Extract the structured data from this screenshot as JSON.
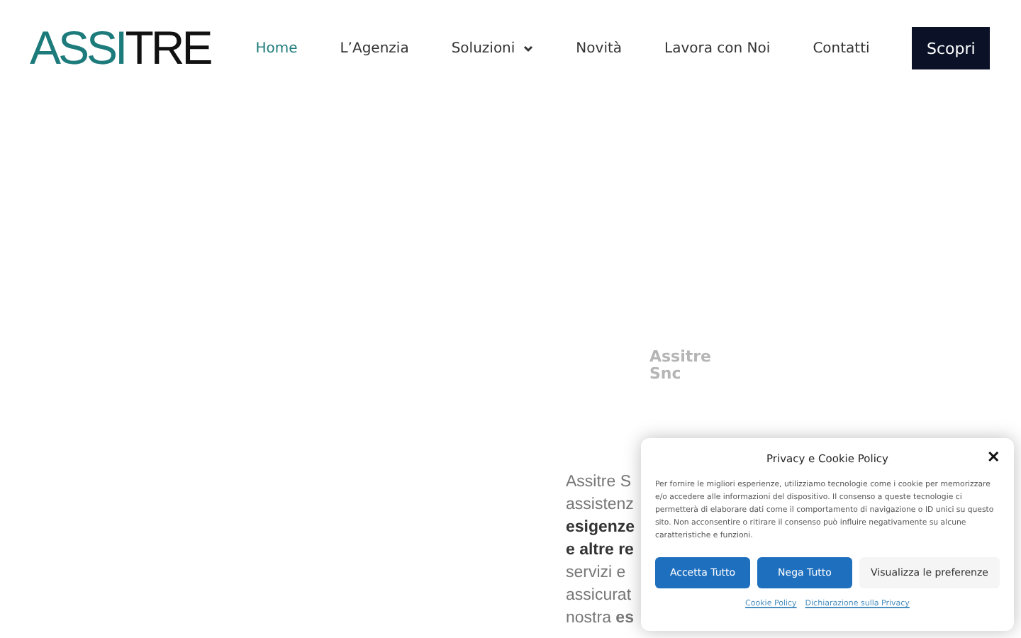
{
  "header": {
    "logo": [
      {
        "text": "ASSI",
        "color": "#1e7b7c"
      },
      {
        "text": "TRE",
        "color": "#111111"
      }
    ],
    "nav": [
      {
        "label": "Home",
        "selected": true,
        "dropdown": false
      },
      {
        "label": "L’Agenzia",
        "selected": false,
        "dropdown": false
      },
      {
        "label": "Soluzioni",
        "selected": false,
        "dropdown": true
      },
      {
        "label": "Novità",
        "selected": false,
        "dropdown": false
      },
      {
        "label": "Lavora con Noi",
        "selected": false,
        "dropdown": false
      },
      {
        "label": "Contatti",
        "selected": false,
        "dropdown": false
      }
    ],
    "cta": "Scopri"
  },
  "hero": {
    "caption": [
      "Assitre",
      "Snc"
    ],
    "lines": [
      {
        "text": "Assitre S",
        "bold": false
      },
      {
        "text": "assistenz",
        "bold": false
      },
      {
        "text": "esigenze",
        "bold": true
      },
      {
        "text": "e altre re",
        "bold": true
      },
      {
        "text": "servizi e",
        "bold": false
      },
      {
        "text": "assicurat",
        "bold": false
      },
      {
        "text": "nostra **es**",
        "bold": false
      }
    ]
  },
  "cookie_dialog": {
    "title": "Privacy e Cookie Policy",
    "close": "✕",
    "body": "Per fornire le migliori esperienze, utilizziamo tecnologie come i cookie per memorizzare e/o accedere alle informazioni del dispositivo. Il consenso a queste tecnologie ci permetterà di elaborare dati come il comportamento di navigazione o ID unici su questo sito. Non acconsentire o ritirare il consenso può influire negativamente su alcune caratteristiche e funzioni.",
    "buttons": [
      {
        "label": "Accetta Tutto",
        "kind": "primary"
      },
      {
        "label": "Nega Tutto",
        "kind": "primary"
      },
      {
        "label": "Visualizza le preferenze",
        "kind": "secondary"
      }
    ],
    "links": [
      "Cookie Policy",
      "Dichiarazione sulla Privacy"
    ]
  }
}
